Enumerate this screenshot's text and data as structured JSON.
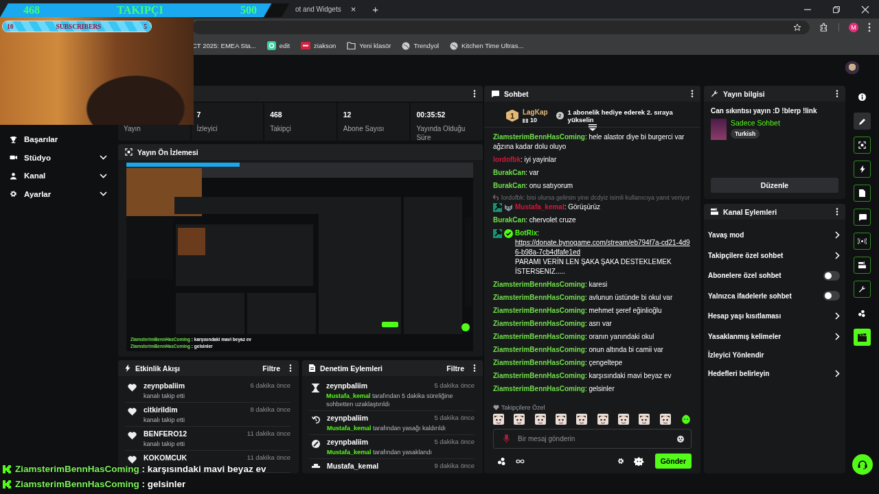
{
  "browser": {
    "tab": {
      "title": "ot and Widgets",
      "close": "×"
    },
    "new_tab": "+",
    "profile_initial": "M",
    "bookmarks": [
      {
        "label": "CT 2025: EMEA Sta...",
        "kind": "page"
      },
      {
        "label": "edit",
        "kind": "app"
      },
      {
        "label": "ziakson",
        "kind": "brand"
      },
      {
        "label": "Yeni klasör",
        "kind": "folder"
      },
      {
        "label": "Trendyol",
        "kind": "globe"
      },
      {
        "label": "Kitchen Time Ultras...",
        "kind": "globe"
      }
    ]
  },
  "overlay": {
    "follower_goal": {
      "current": "468",
      "label": "TAKIPÇI",
      "target": "500",
      "level": 0.936
    },
    "sub_goal": {
      "current": "10",
      "label": "SUBSCRIBERS",
      "target": "5",
      "level": 1
    },
    "chat_lines": [
      {
        "user": "ZiamsterimBennHasComing",
        "text": ": karşısındaki mavi beyaz ev"
      },
      {
        "user": "ZiamsterimBennHasComing",
        "text": ": gelsinler"
      }
    ]
  },
  "sidebar": {
    "items": [
      {
        "label": "Başarılar",
        "kind": "link"
      },
      {
        "label": "Stüdyo",
        "kind": "group",
        "expanded": false
      },
      {
        "label": "Kanal",
        "kind": "group",
        "expanded": false
      },
      {
        "label": "Ayarlar",
        "kind": "group",
        "expanded": false
      }
    ]
  },
  "stats": {
    "items": [
      {
        "label": "Yayın"
      },
      {
        "value": "7",
        "label": "İzleyici"
      },
      {
        "value": "468",
        "label": "Takipçi"
      },
      {
        "value": "12",
        "label": "Abone Sayısı"
      },
      {
        "value": "00:35:52",
        "label": "Yayında Olduğu Süre"
      }
    ]
  },
  "preview": {
    "title": "Yayın Ön İzlemesi",
    "chat_lines": [
      {
        "user": "ZiamsterimBennHasComing",
        "text": ": karşısındaki mavi beyaz ev"
      },
      {
        "user": "ZiamsterimBennHasComing",
        "text": ": gelsinler"
      }
    ]
  },
  "events": {
    "title": "Etkinlik Akışı",
    "filter": "Filtre",
    "items": [
      {
        "user": "zeynpbaliim",
        "detail": "kanalı takip etti",
        "time": "6 dakika önce"
      },
      {
        "user": "citkirildim",
        "detail": "kanalı takip etti",
        "time": "8 dakika önce"
      },
      {
        "user": "BENFERO12",
        "detail": "kanalı takip etti",
        "time": "11 dakika önce"
      },
      {
        "user": "KOKOMCUK",
        "time": "11 dakika önce"
      }
    ]
  },
  "moderation": {
    "title": "Denetim Eylemleri",
    "filter": "Filtre",
    "items": [
      {
        "kind": "timeout",
        "user": "zeynpbaliim",
        "time": "5 dakika önce",
        "actor": "Mustafa_kemal",
        "detail": "tarafından 5 dakika süreliğine sohbetten uzaklaştırıldı"
      },
      {
        "kind": "unban",
        "user": "zeynpbaliim",
        "time": "5 dakika önce",
        "actor": "Mustafa_kemal",
        "detail": "tarafından yasağı kaldırıldı"
      },
      {
        "kind": "ban",
        "user": "zeynpbaliim",
        "time": "5 dakika önce",
        "actor": "Mustafa_kemal",
        "detail": "tarafından yasaklandı"
      },
      {
        "kind": "other",
        "user": "Mustafa_kemal",
        "time": "9 dakika önce"
      }
    ]
  },
  "chat": {
    "title": "Sohbet",
    "leader": {
      "rank": "1",
      "user": "LagKap",
      "count": "10",
      "goal_rank": "2",
      "goal": "1 abonelik hediye ederek 2. sıraya yükselin"
    },
    "messages": [
      {
        "user": "ZiamsterimBennHasComing",
        "color": "#6fe048",
        "text": ": hele alastor diye bi burgerci var ağzına kadar dolu oluyo"
      },
      {
        "user": "lordofbk",
        "color": "#d0183c",
        "text": ": iyi yayinlar"
      },
      {
        "user": "BurakCan",
        "color": "#6fe048",
        "text": ": var"
      },
      {
        "user": "BurakCan",
        "color": "#6fe048",
        "text": ": onu satıyorum"
      },
      {
        "reply_to": "lordofbk: bisi olursa gelirsin yine dcdyiz isimli kullanıcıya yanıt veriyor",
        "badges": [
          {
            "kind": "moderator"
          },
          {
            "kind": "emote"
          }
        ],
        "user": "Mustafa_kemal",
        "color": "#d0183c",
        "text": ": Görüşürüz"
      },
      {
        "user": "BurakCan",
        "color": "#6fe048",
        "text": ": chervolet cruze"
      },
      {
        "badges": [
          {
            "kind": "moderator"
          },
          {
            "kind": "verified"
          }
        ],
        "user": "BotRix",
        "color": "#53fc18",
        "text": ":",
        "link": "https://donate.bynogame.com/stream/eb794f7a-cd21-4d96-b98a-7cb4dfafe1ed",
        "after": "PARAMI VERİN LEN ŞAKA ŞAKA DESTEKLEMEK İSTERSENIZ....."
      },
      {
        "user": "ZiamsterimBennHasComing",
        "color": "#6fe048",
        "text": ": karesi"
      },
      {
        "user": "ZiamsterimBennHasComing",
        "color": "#6fe048",
        "text": ": avlunun üstünde bi okul var"
      },
      {
        "user": "ZiamsterimBennHasComing",
        "color": "#6fe048",
        "text": ": mehmet şeref eğinlioğlu"
      },
      {
        "user": "ZiamsterimBennHasComing",
        "color": "#6fe048",
        "text": ": asrı var"
      },
      {
        "user": "ZiamsterimBennHasComing",
        "color": "#6fe048",
        "text": ": oranın yanındaki okul"
      },
      {
        "user": "ZiamsterimBennHasComing",
        "color": "#6fe048",
        "text": ": onun altında bi camii var"
      },
      {
        "user": "ZiamsterimBennHasComing",
        "color": "#6fe048",
        "text": ": çengeltepe"
      },
      {
        "user": "ZiamsterimBennHasComing",
        "color": "#6fe048",
        "text": ": karşısındaki mavi beyaz ev"
      },
      {
        "user": "ZiamsterimBennHasComing",
        "color": "#6fe048",
        "text": ": gelsinler"
      }
    ],
    "emote_section": "Takipçilere Özel",
    "input": {
      "placeholder": "Bir mesaj gönderin"
    },
    "send": "Gönder"
  },
  "stream_info": {
    "title": "Yayın bilgisi",
    "stream_title": "Can sıkıntısı yayın :D !blerp !link",
    "category": "Sadece Sohbet",
    "tags": [
      "Turkish"
    ],
    "edit": "Düzenle"
  },
  "channel_actions": {
    "title": "Kanal Eylemleri",
    "items": [
      {
        "label": "Yavaş mod",
        "kind": "submenu"
      },
      {
        "label": "Takipçilere özel sohbet",
        "kind": "submenu"
      },
      {
        "label": "Abonelere özel sohbet",
        "kind": "toggle",
        "on": false
      },
      {
        "label": "Yalnızca ifadelerle sohbet",
        "kind": "toggle",
        "on": false
      },
      {
        "label": "Hesap yaşı kısıtlaması",
        "kind": "submenu"
      },
      {
        "label": "Yasaklanmış kelimeler",
        "kind": "submenu"
      },
      {
        "label": "İzleyici Yönlendir",
        "kind": "action"
      },
      {
        "label": "Hedefleri belirleyin",
        "kind": "submenu"
      }
    ]
  },
  "rail": {
    "items": [
      {
        "kind": "plain",
        "selected": false
      },
      {
        "kind": "plain",
        "selected": true
      },
      {
        "kind": "outlined",
        "selected": false
      },
      {
        "kind": "outlined",
        "selected": false
      },
      {
        "kind": "outlined",
        "selected": false
      },
      {
        "kind": "outlined",
        "selected": false
      },
      {
        "kind": "outlined",
        "selected": false
      },
      {
        "kind": "outlined",
        "selected": false
      },
      {
        "kind": "outlined",
        "selected": false
      },
      {
        "kind": "plain",
        "selected": false
      },
      {
        "kind": "filled",
        "selected": false
      }
    ]
  }
}
